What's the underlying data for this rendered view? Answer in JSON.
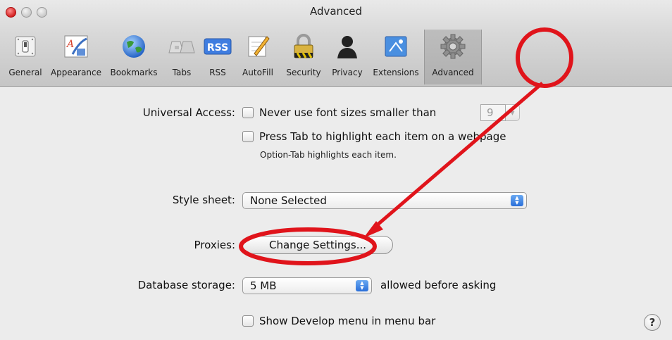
{
  "window": {
    "title": "Advanced"
  },
  "toolbar": {
    "items": [
      {
        "label": "General",
        "icon": "switch-icon"
      },
      {
        "label": "Appearance",
        "icon": "font-icon"
      },
      {
        "label": "Bookmarks",
        "icon": "globe-icon"
      },
      {
        "label": "Tabs",
        "icon": "tabs-icon"
      },
      {
        "label": "RSS",
        "icon": "rss-icon"
      },
      {
        "label": "AutoFill",
        "icon": "pencil-icon"
      },
      {
        "label": "Security",
        "icon": "lock-icon"
      },
      {
        "label": "Privacy",
        "icon": "person-icon"
      },
      {
        "label": "Extensions",
        "icon": "puzzle-icon"
      },
      {
        "label": "Advanced",
        "icon": "gear-icon"
      }
    ],
    "selected": "Advanced"
  },
  "universal_access": {
    "label": "Universal Access:",
    "font_size_option": "Never use font sizes smaller than",
    "font_size_value": "9",
    "tab_option": "Press Tab to highlight each item on a webpage",
    "tab_note": "Option-Tab highlights each item."
  },
  "style_sheet": {
    "label": "Style sheet:",
    "value": "None Selected"
  },
  "proxies": {
    "label": "Proxies:",
    "button": "Change Settings..."
  },
  "database_storage": {
    "label": "Database storage:",
    "value": "5 MB",
    "suffix": "allowed before asking"
  },
  "develop_menu": {
    "label": "Show Develop menu in menu bar"
  },
  "help": {
    "symbol": "?"
  },
  "annotation": {
    "color": "#e0141b"
  }
}
